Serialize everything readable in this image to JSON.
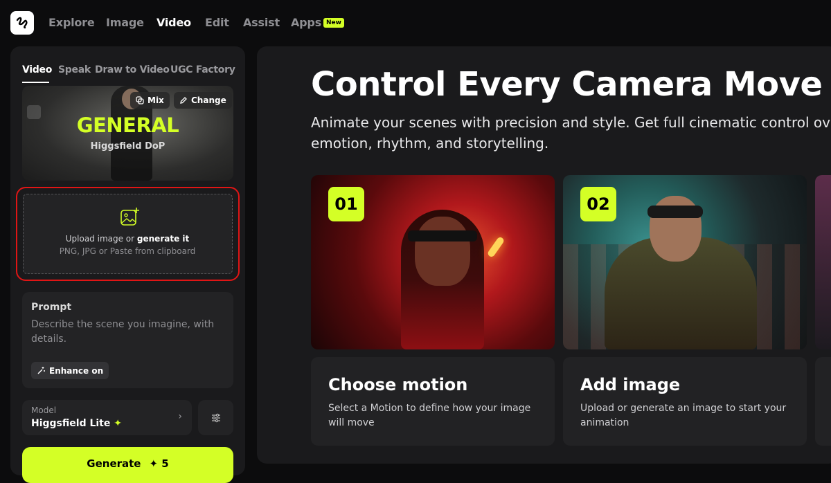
{
  "nav": {
    "items": [
      "Explore",
      "Image",
      "Video",
      "Edit",
      "Assist",
      "Apps"
    ],
    "active": "Video",
    "new_badge": "New"
  },
  "left": {
    "tabs": [
      "Video",
      "Speak",
      "Draw to Video",
      "UGC Factory"
    ],
    "preset": {
      "title": "GENERAL",
      "subtitle": "Higgsfield DoP",
      "mix_label": "Mix",
      "change_label": "Change"
    },
    "upload": {
      "line1_prefix": "Upload image or ",
      "line1_bold": "generate it",
      "line2": "PNG, JPG or Paste from clipboard"
    },
    "prompt": {
      "label": "Prompt",
      "placeholder": "Describe the scene you imagine, with details.",
      "enhance_label": "Enhance on"
    },
    "model": {
      "label": "Model",
      "value": "Higgsfield Lite",
      "spark": "✦"
    },
    "generate": {
      "label": "Generate",
      "cost": "✦ 5"
    }
  },
  "main": {
    "title": "Control Every Camera Move",
    "subtitle_line1": "Animate your scenes with precision and style. Get full cinematic control over how",
    "subtitle_line2": "emotion, rhythm, and storytelling.",
    "cards": [
      {
        "num": "01",
        "title": "Choose motion",
        "desc": "Select a Motion to define how your image will move"
      },
      {
        "num": "02",
        "title": "Add image",
        "desc": "Upload or generate an image to start your animation"
      }
    ]
  },
  "colors": {
    "accent": "#d4ff26",
    "highlight_border": "#e01515",
    "panel": "#1a1a1c"
  }
}
